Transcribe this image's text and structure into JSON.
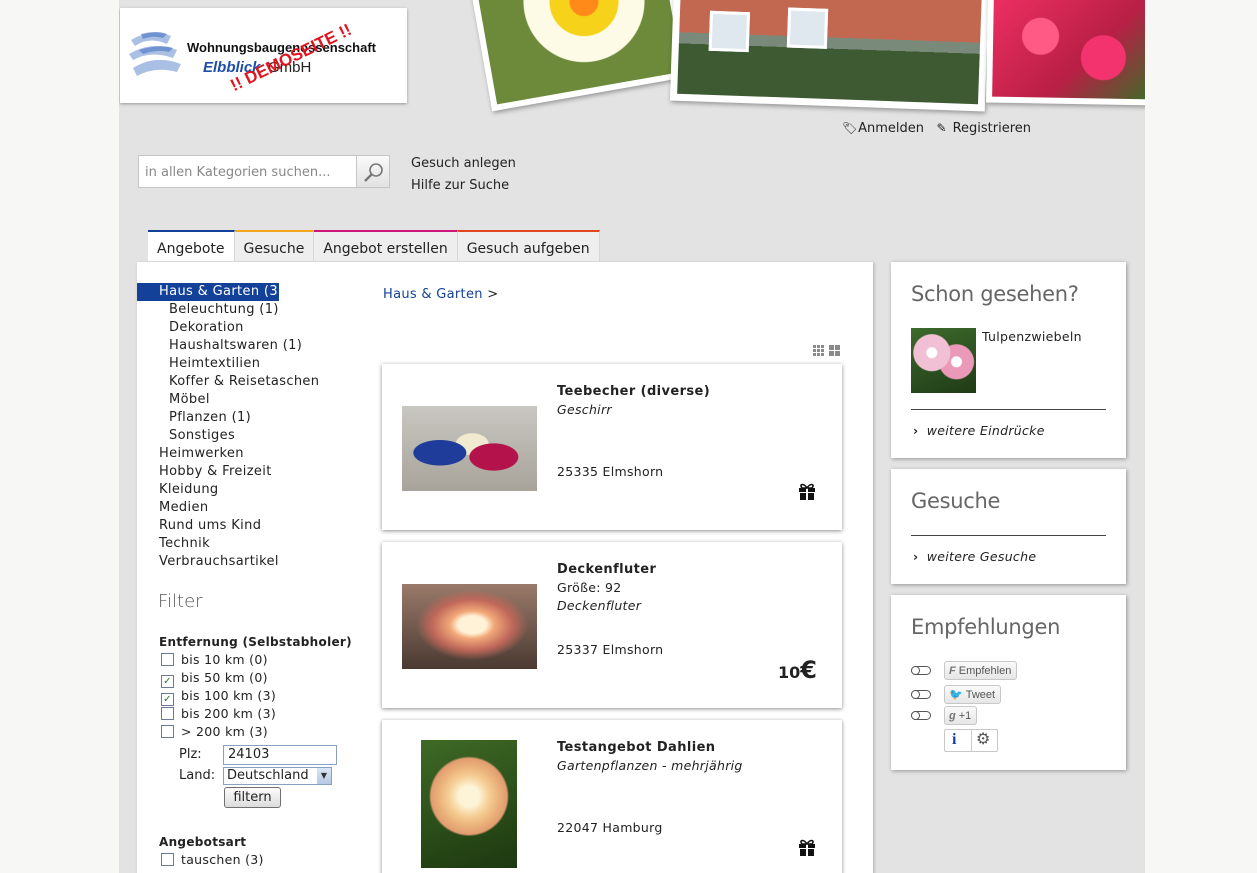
{
  "header": {
    "logo_line1": "Wohnungsbaugenossenschaft",
    "logo_line2_brand": "Elbblick",
    "logo_line2_suffix": "GmbH",
    "demo_stamp": "!! DEMOSEITE !!"
  },
  "user_links": {
    "login": "Anmelden",
    "register": "Registrieren"
  },
  "search": {
    "placeholder": "in allen Kategorien suchen...",
    "create_request": "Gesuch anlegen",
    "help": "Hilfe zur Suche"
  },
  "tabs": [
    {
      "label": "Angebote",
      "color": "#13419a"
    },
    {
      "label": "Gesuche",
      "color": "#f3a61c"
    },
    {
      "label": "Angebot erstellen",
      "color": "#d0157a"
    },
    {
      "label": "Gesuch aufgeben",
      "color": "#e2461e"
    }
  ],
  "categories": [
    {
      "label": "Haus & Garten (3)",
      "level": "top",
      "selected": true
    },
    {
      "label": "Beleuchtung (1)",
      "level": "sub"
    },
    {
      "label": "Dekoration",
      "level": "sub"
    },
    {
      "label": "Haushaltswaren (1)",
      "level": "sub"
    },
    {
      "label": "Heimtextilien",
      "level": "sub"
    },
    {
      "label": "Koffer & Reisetaschen",
      "level": "sub"
    },
    {
      "label": "Möbel",
      "level": "sub"
    },
    {
      "label": "Pflanzen (1)",
      "level": "sub"
    },
    {
      "label": "Sonstiges",
      "level": "sub"
    },
    {
      "label": "Heimwerken",
      "level": "top"
    },
    {
      "label": "Hobby & Freizeit",
      "level": "top"
    },
    {
      "label": "Kleidung",
      "level": "top"
    },
    {
      "label": "Medien",
      "level": "top"
    },
    {
      "label": "Rund ums Kind",
      "level": "top"
    },
    {
      "label": "Technik",
      "level": "top"
    },
    {
      "label": "Verbrauchsartikel",
      "level": "top"
    }
  ],
  "filter": {
    "title": "Filter",
    "distance_heading": "Entfernung (Selbstabholer)",
    "distance_options": [
      {
        "label": "bis 10 km (0)",
        "checked": false
      },
      {
        "label": "bis 50 km (0)",
        "checked": true
      },
      {
        "label": "bis 100 km (3)",
        "checked": true
      },
      {
        "label": "bis 200 km (3)",
        "checked": false
      },
      {
        "label": "> 200 km (3)",
        "checked": false
      }
    ],
    "plz_label": "Plz:",
    "plz_value": "24103",
    "land_label": "Land:",
    "land_value": "Deutschland",
    "submit": "filtern",
    "offer_type_heading": "Angebotsart",
    "offer_type_options": [
      {
        "label": "tauschen (3)",
        "checked": false
      }
    ]
  },
  "breadcrumb": {
    "link": "Haus & Garten",
    "sep": ">"
  },
  "offers": [
    {
      "title": "Teebecher (diverse)",
      "detail": "",
      "category": "Geschirr",
      "location": "25335 Elmshorn",
      "price_type": "gift",
      "price": "",
      "currency": "",
      "thumb": "cups"
    },
    {
      "title": "Deckenfluter",
      "detail": "Größe: 92",
      "category": "Deckenfluter",
      "location": "25337 Elmshorn",
      "price_type": "price",
      "price": "10",
      "currency": "€",
      "thumb": "lamp"
    },
    {
      "title": "Testangebot Dahlien",
      "detail": "",
      "category": "Gartenpflanzen - mehrjährig",
      "location": "22047 Hamburg",
      "price_type": "gift",
      "price": "",
      "currency": "",
      "thumb": "dahlia"
    }
  ],
  "sidebar": {
    "seen": {
      "title": "Schon gesehen?",
      "item": "Tulpenzwiebeln",
      "more": "weitere Eindrücke"
    },
    "requests": {
      "title": "Gesuche",
      "more": "weitere Gesuche"
    },
    "recommend": {
      "title": "Empfehlungen",
      "facebook": "Empfehlen",
      "twitter": "Tweet",
      "google": "+1"
    }
  }
}
